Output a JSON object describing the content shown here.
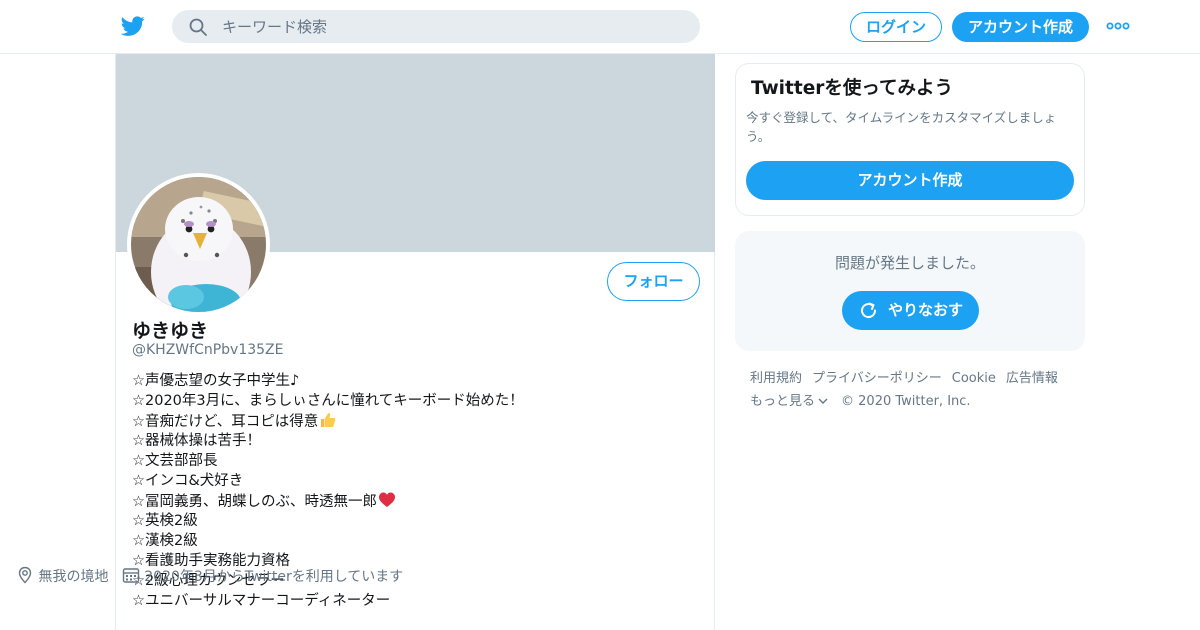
{
  "header": {
    "search_placeholder": "キーワード検索",
    "login_label": "ログイン",
    "signup_label": "アカウント作成"
  },
  "colors": {
    "accent": "#1da1f2",
    "banner": "#ccd6dd",
    "muted_text": "#657786",
    "panel_bg": "#f5f8fa"
  },
  "profile": {
    "follow_label": "フォロー",
    "display_name": "ゆきゆき",
    "handle": "@KHZWfCnPbv135ZE",
    "bio_lines": [
      "☆声優志望の女子中学生♪",
      "☆2020年3月に、まらしぃさんに憧れてキーボード始めた！",
      "☆音痴だけど、耳コピは得意",
      "☆器械体操は苦手！",
      "☆文芸部部長",
      "☆インコ&犬好き",
      "☆冨岡義勇、胡蝶しのぶ、時透無一郎",
      "☆英検2級",
      "☆漢検2級",
      "☆看護助手実務能力資格",
      "☆2級心理カウンセラー",
      "☆ユニバーサルマナーコーディネーター"
    ],
    "location": "無我の境地",
    "joined": "2020年3月からTwitterを利用しています"
  },
  "signup_card": {
    "title": "Twitterを使ってみよう",
    "subtitle": "今すぐ登録して、タイムラインをカスタマイズしましょう。",
    "button_label": "アカウント作成"
  },
  "error_panel": {
    "message": "問題が発生しました。",
    "retry_label": "やりなおす"
  },
  "footer": {
    "links": [
      "利用規約",
      "プライバシーポリシー",
      "Cookie",
      "広告情報"
    ],
    "more_label": "もっと見る",
    "copyright": "© 2020 Twitter, Inc."
  },
  "icons": {
    "logo": "twitter-bird-icon",
    "search": "search-icon",
    "more": "more-horizontal-icon",
    "thumbs_up": "thumbs-up-emoji",
    "heart": "red-heart-emoji",
    "location": "location-pin-icon",
    "calendar": "calendar-icon",
    "refresh": "refresh-icon",
    "chevron": "chevron-down-icon"
  }
}
